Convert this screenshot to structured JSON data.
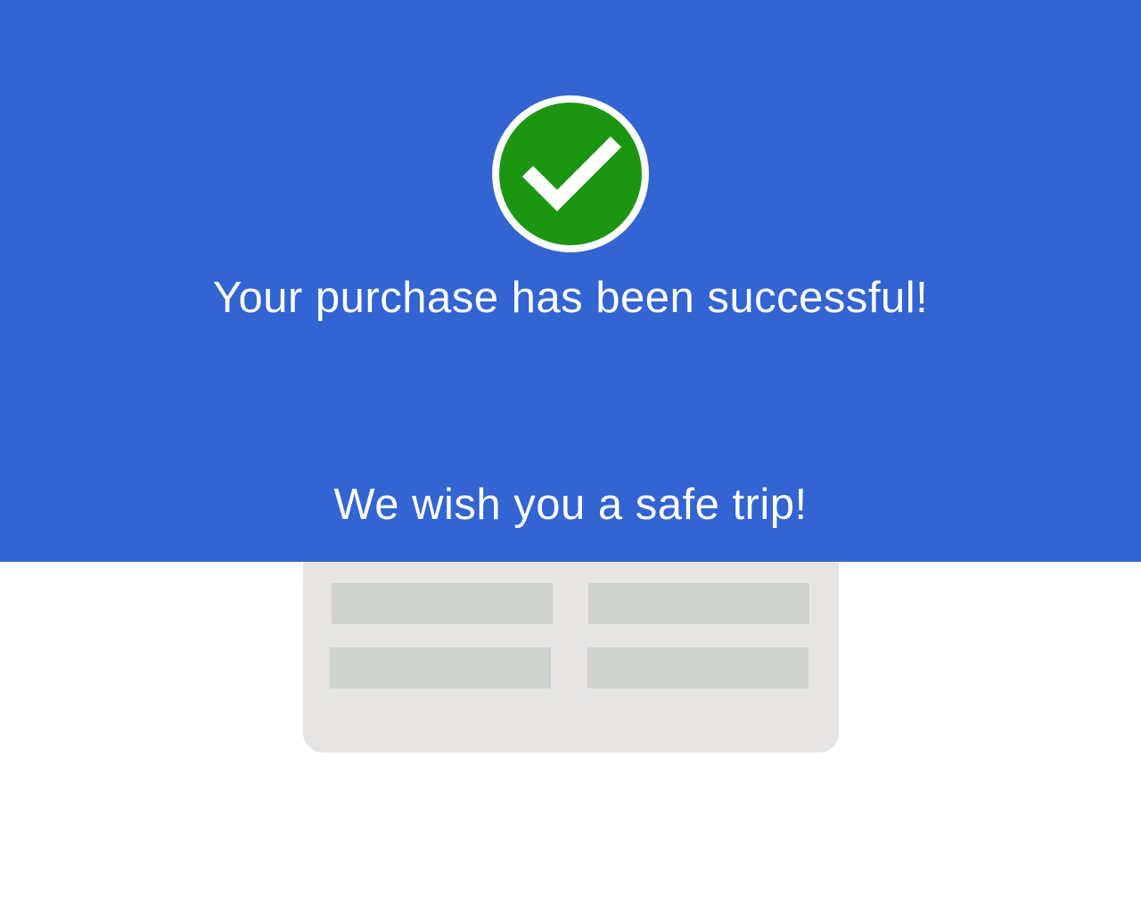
{
  "colors": {
    "hero_background": "#3264d2",
    "success_green": "#1c9612",
    "text": "#ffffff",
    "card_background": "#e6e5e4",
    "placeholder_block": "#cfd3cf"
  },
  "success_icon": {
    "name": "checkmark-circle-icon"
  },
  "headline": "Your purchase has been successful!",
  "subline": "We wish you a safe trip!",
  "ticket_card": {
    "placeholder_count": 4
  }
}
